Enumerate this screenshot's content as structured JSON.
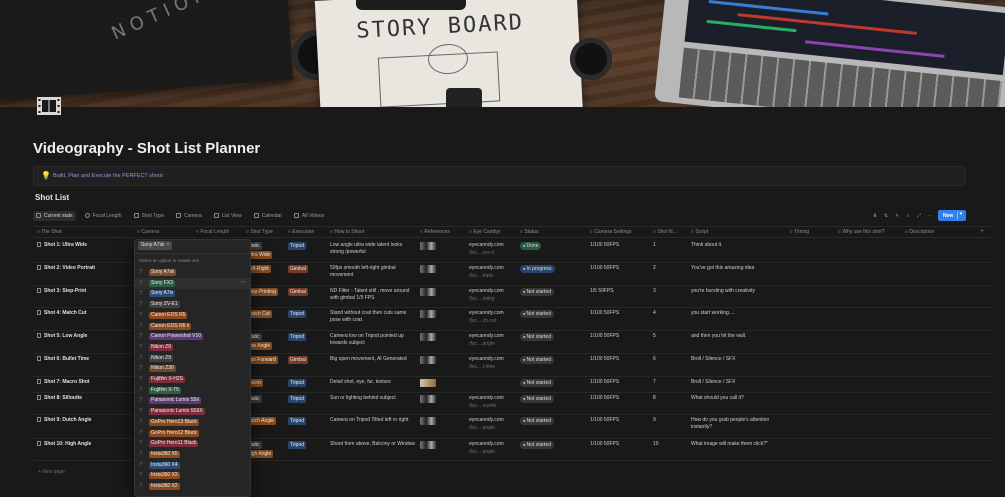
{
  "cover": {
    "notebook_text": "NOTION",
    "storyboard_text": "STORY BOARD"
  },
  "page": {
    "title": "Videography - Shot List Planner",
    "callout_text": "Build, Plan and Execute the PERFECT shoot",
    "callout_icon": "lightbulb-icon"
  },
  "database": {
    "title": "Shot List",
    "views": [
      "Current stats",
      "Focal Length",
      "Shot Type",
      "Camera",
      "List View",
      "Calendar",
      "All Videos"
    ],
    "new_label": "New",
    "new_page_label": "+ New page",
    "columns": [
      "The Shot",
      "Camera",
      "Focal Length",
      "Shot Type",
      "Execution",
      "How to Shoot",
      "References",
      "Eye Candyy",
      "Status",
      "Camera Settings",
      "Shot N...",
      "Script",
      "Timing",
      "Why use this shot?",
      "Description"
    ]
  },
  "rows": [
    {
      "shot": "Shot 1: Ultra Wide",
      "shot_type": "Static",
      "shot_type2": "Ultra Wide",
      "execution": "Tripod",
      "how": "Low angle ultra wide talent looks strong /powerful",
      "eye": "eyecanndy.com",
      "eye2": "(fsc....ser-d",
      "status": "Done",
      "settings": "1/100 50FPS",
      "num": "1",
      "script": "Think about it."
    },
    {
      "shot": "Shot 2: Video Portrait",
      "shot_type": "Left-Right",
      "shot_type2": "",
      "execution": "Gimbal",
      "how": "50fps smooth left-right gimbal movement",
      "eye": "eyecanndy.com",
      "eye2": "(fsc....trails",
      "status": "In progress",
      "settings": "1/100 50FPS",
      "num": "2",
      "script": "You've got this amazing idea"
    },
    {
      "shot": "Shot 3: Step-Print",
      "shot_type": "Step-Printing",
      "shot_type2": "",
      "execution": "Gimbal",
      "how": "ND Filter - Talent still , move around with gimbal 1/5 FPS",
      "eye": "eyecanndy.com",
      "eye2": "(fsc....inting",
      "status": "Not started",
      "settings": "1/5 50FPS",
      "num": "3",
      "script": "you're bursting with creativity"
    },
    {
      "shot": "Shot 4: Match Cut",
      "shot_type": "Match Cut",
      "shot_type2": "",
      "execution": "Tripod",
      "how": "Stand without coat then cuts same pose with coat",
      "eye": "eyecanndy.com",
      "eye2": "(fsc....ch-cut",
      "status": "Not started",
      "settings": "1/100 50FPS",
      "num": "4",
      "script": "you start working...."
    },
    {
      "shot": "Shot 5: Low Angle",
      "shot_type": "Static",
      "shot_type2": "Low Angle",
      "execution": "Tripod",
      "how": "Camera low on Tripod pointed up towards subject",
      "eye": "eyecanndy.com",
      "eye2": "(fsc....angle",
      "status": "Not started",
      "settings": "1/100 50FPS",
      "num": "5",
      "script": " and then you hit the wall."
    },
    {
      "shot": "Shot 6: Bullet Time",
      "shot_type": "Pan Forward",
      "shot_type2": "",
      "execution": "Gimbal",
      "how": "Big open movement, AI Generated",
      "eye": "eyecanndy.com",
      "eye2": "(fsc....t-time",
      "status": "Not started",
      "settings": "1/100 50FPS",
      "num": "6",
      "script": "Broll / Silence / SFX"
    },
    {
      "shot": "Shot 7: Macro Shot",
      "shot_type": "Macro",
      "shot_type2": "",
      "execution": "Tripod",
      "how": "Detail shot, eye, fur, texture",
      "eye": "",
      "eye2": "",
      "status": "Not started",
      "settings": "1/100 50FPS",
      "num": "7",
      "script": "Broll / Silence / SFX"
    },
    {
      "shot": "Shot 8: Silloutte",
      "shot_type": "Static",
      "shot_type2": "",
      "execution": "Tripod",
      "how": "Sun or lighting behind subject",
      "eye": "eyecanndy.com",
      "eye2": "(fsc....ouette",
      "status": "Not started",
      "settings": "1/100 50FPS",
      "num": "8",
      "script": "What should you call it?"
    },
    {
      "shot": "Shot 9: Dutch Angle",
      "shot_type": "Dutch Angle",
      "shot_type2": "",
      "execution": "Tripod",
      "how": "Camera on Tripod Tilted left or right",
      "eye": "eyecanndy.com",
      "eye2": "(fsc....angle",
      "status": "Not started",
      "settings": "1/100 50FPS",
      "num": "9",
      "script": "How do you grab people's attention instantly?"
    },
    {
      "shot": "Shot 10: High Angle",
      "shot_type": "Static",
      "shot_type2": "High Angle",
      "execution": "Tripod",
      "how": "Shoot from above, Balcony or Window",
      "eye": "eyecanndy.com",
      "eye2": "(fsc....angle",
      "status": "Not started",
      "settings": "1/100 50FPS",
      "num": "10",
      "script": " What image will make them click?\""
    }
  ],
  "dropdown": {
    "selected": "Sony A7sii",
    "hint": "Select an option or create one",
    "options": [
      {
        "label": "Sony A7sii",
        "color": "#7d4a2a"
      },
      {
        "label": "Sony FX3",
        "color": "#2f5d46"
      },
      {
        "label": "Sony A7iv",
        "color": "#2b4d73"
      },
      {
        "label": "Sony ZV-E1",
        "color": "#404040"
      },
      {
        "label": "Canon EOS R5",
        "color": "#8a4a1e"
      },
      {
        "label": "Canon EOS R6 ii",
        "color": "#8a4a1e"
      },
      {
        "label": "Canon Powershot V10",
        "color": "#5a3a7a"
      },
      {
        "label": "Nikon Z8",
        "color": "#7a2e3a"
      },
      {
        "label": "Nikon Z9",
        "color": "#404040"
      },
      {
        "label": "Nikon Z30",
        "color": "#6a4a2a"
      },
      {
        "label": "Fujifilm X-H2S",
        "color": "#7a2e3a"
      },
      {
        "label": "Fujifilm X-T5",
        "color": "#2f5d46"
      },
      {
        "label": "Panasonic Lumix S5ii",
        "color": "#5a3a7a"
      },
      {
        "label": "Panasonic Lumix S5IIX",
        "color": "#7a2e3a"
      },
      {
        "label": "GoPro Hero13 Black",
        "color": "#8a4a1e"
      },
      {
        "label": "GoPro Hero12 Black",
        "color": "#8a4a1e"
      },
      {
        "label": "GoPro Hero11 Black",
        "color": "#7a2e3a"
      },
      {
        "label": "Insta360 X5",
        "color": "#8a4a1e"
      },
      {
        "label": "Insta360 X4",
        "color": "#2b4d73"
      },
      {
        "label": "Insta360 X3",
        "color": "#8a4a1e"
      },
      {
        "label": "Insta360 X2",
        "color": "#8a4a1e"
      }
    ]
  },
  "colors": {
    "accent": "#2f80ed",
    "background": "#191919",
    "done": "#2b593f",
    "in_progress": "#28456c"
  }
}
